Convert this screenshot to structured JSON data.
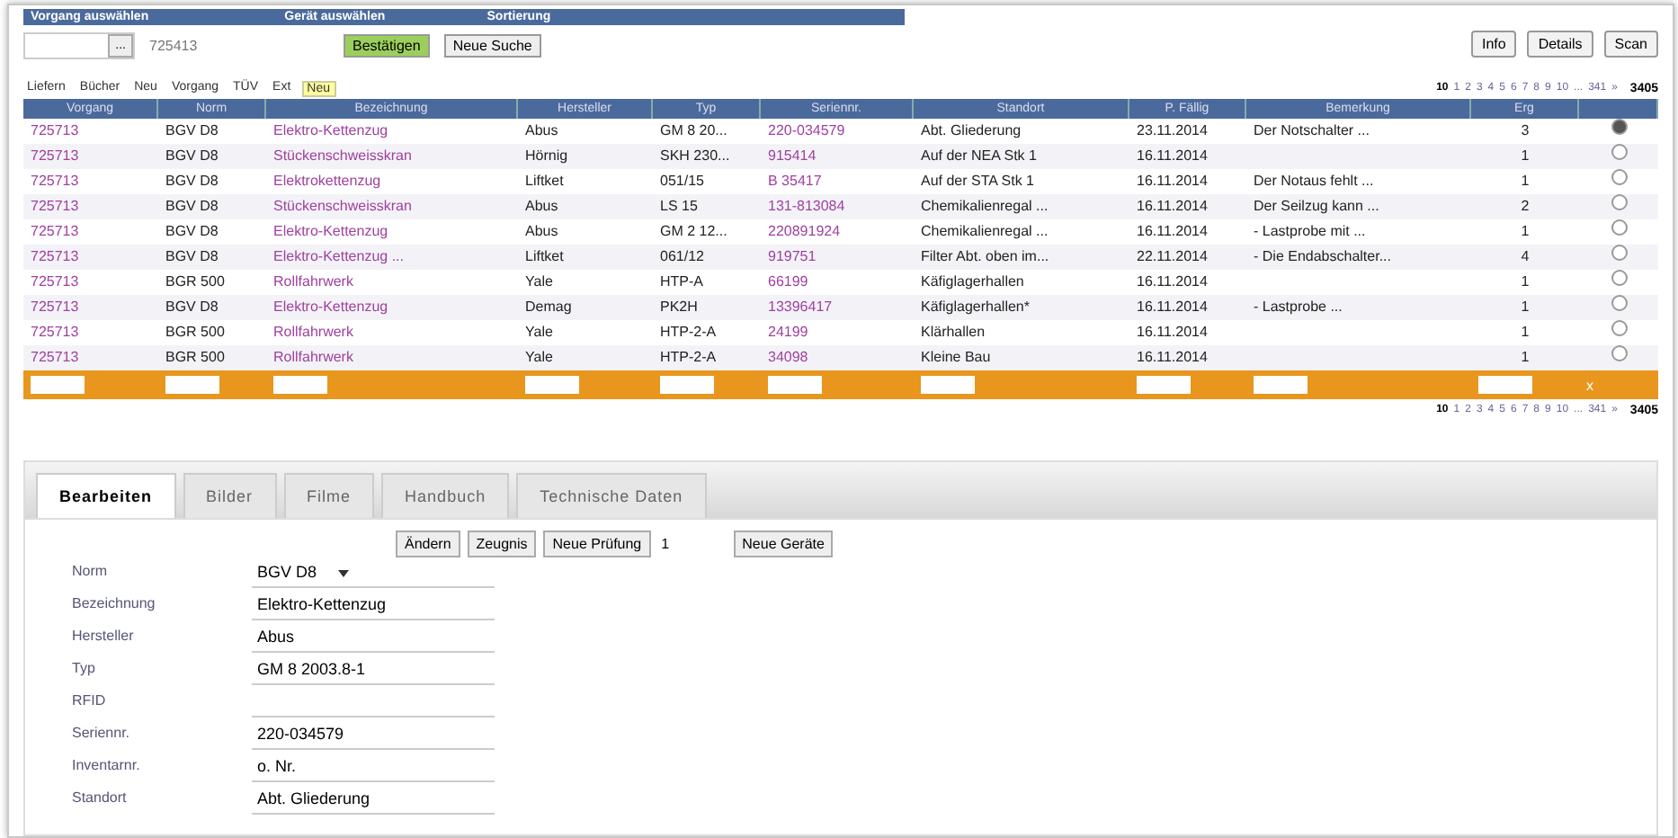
{
  "search_bar": {
    "headers": [
      "Vorgang auswählen",
      "Gerät auswählen",
      "Sortierung"
    ],
    "lookup_label": "...",
    "number": "725413",
    "buttons": [
      {
        "label": "Bestätigen",
        "kind": "primary"
      },
      {
        "label": "Neue Suche",
        "kind": "plain"
      }
    ]
  },
  "top_buttons": [
    "Info",
    "Details",
    "Scan"
  ],
  "filter_links": [
    {
      "label": "Liefern",
      "selected": false
    },
    {
      "label": "Bücher",
      "selected": false
    },
    {
      "label": "Neu",
      "selected": false
    },
    {
      "label": "Vorgang",
      "selected": false
    },
    {
      "label": "TÜV",
      "selected": false
    },
    {
      "label": "Ext",
      "selected": false
    },
    {
      "label": "Neu",
      "selected": true
    }
  ],
  "pager_top": {
    "pages": [
      "10",
      "1",
      "2",
      "3",
      "4",
      "5",
      "6",
      "7",
      "8",
      "9",
      "10",
      "...",
      "341",
      "»"
    ],
    "total": "3405"
  },
  "table": {
    "columns": [
      {
        "label": "Vorgang",
        "filterable": true
      },
      {
        "label": "Norm",
        "filterable": true
      },
      {
        "label": "Bezeichnung",
        "filterable": true
      },
      {
        "label": "Hersteller",
        "filterable": true
      },
      {
        "label": "Typ",
        "filterable": true
      },
      {
        "label": "Seriennr.",
        "filterable": true
      },
      {
        "label": "Standort",
        "filterable": true
      },
      {
        "label": "P. Fällig",
        "filterable": true
      },
      {
        "label": "Bemerkung",
        "filterable": true
      },
      {
        "label": "Erg",
        "filterable": true
      }
    ],
    "reset_label": "x",
    "rows": [
      {
        "cells": [
          "725713",
          "BGV D8",
          "Elektro-Kettenzug",
          "Abus",
          "GM 8 20...",
          "220-034579",
          "Abt. Gliederung",
          "23.11.2014",
          "Der Notschalter ...",
          "3"
        ],
        "selected": true
      },
      {
        "cells": [
          "725713",
          "BGV D8",
          "Stückenschweisskran",
          "Hörnig",
          "SKH 230...",
          "915414",
          "Auf der NEA Stk 1",
          "16.11.2014",
          "",
          "1"
        ],
        "selected": false
      },
      {
        "cells": [
          "725713",
          "BGV D8",
          "Elektrokettenzug",
          "Liftket",
          "051/15",
          "B 35417",
          "Auf der STA Stk 1",
          "16.11.2014",
          "Der Notaus fehlt ...",
          "1"
        ],
        "selected": false
      },
      {
        "cells": [
          "725713",
          "BGV D8",
          "Stückenschweisskran",
          "Abus",
          "LS 15",
          "131-813084",
          "Chemikalienregal ...",
          "16.11.2014",
          "Der Seilzug kann ...",
          "2"
        ],
        "selected": false
      },
      {
        "cells": [
          "725713",
          "BGV D8",
          "Elektro-Kettenzug",
          "Abus",
          "GM 2 12...",
          "220891924",
          "Chemikalienregal ...",
          "16.11.2014",
          "- Lastprobe mit ...",
          "1"
        ],
        "selected": false
      },
      {
        "cells": [
          "725713",
          "BGV D8",
          "Elektro-Kettenzug ...",
          "Liftket",
          "061/12",
          "919751",
          "Filter Abt. oben im...",
          "22.11.2014",
          "- Die Endabschalter...",
          "4"
        ],
        "selected": false
      },
      {
        "cells": [
          "725713",
          "BGR 500",
          "Rollfahrwerk",
          "Yale",
          "HTP-A",
          "66199",
          "Käfiglagerhallen",
          "16.11.2014",
          "",
          "1"
        ],
        "selected": false
      },
      {
        "cells": [
          "725713",
          "BGV D8",
          "Elektro-Kettenzug",
          "Demag",
          "PK2H",
          "13396417",
          "Käfiglagerhallen*",
          "16.11.2014",
          "- Lastprobe ...",
          "1"
        ],
        "selected": false
      },
      {
        "cells": [
          "725713",
          "BGR 500",
          "Rollfahrwerk",
          "Yale",
          "HTP-2-A",
          "24199",
          "Klärhallen",
          "16.11.2014",
          "",
          "1"
        ],
        "selected": false
      },
      {
        "cells": [
          "725713",
          "BGR 500",
          "Rollfahrwerk",
          "Yale",
          "HTP-2-A",
          "34098",
          "Kleine Bau",
          "16.11.2014",
          "",
          "1"
        ],
        "selected": false
      }
    ]
  },
  "pager_bottom": {
    "pages": [
      "10",
      "1",
      "2",
      "3",
      "4",
      "5",
      "6",
      "7",
      "8",
      "9",
      "10",
      "...",
      "341",
      "»"
    ],
    "total": "3405"
  },
  "tabs": [
    {
      "label": "Bearbeiten",
      "selected": true
    },
    {
      "label": "Bilder",
      "selected": false
    },
    {
      "label": "Filme",
      "selected": false
    },
    {
      "label": "Handbuch",
      "selected": false
    },
    {
      "label": "Technische Daten",
      "selected": false
    }
  ],
  "actions": [
    {
      "kind": "button",
      "label": "Ändern"
    },
    {
      "kind": "button",
      "label": "Zeugnis"
    },
    {
      "kind": "button",
      "label": "Neue Prüfung"
    },
    {
      "kind": "input",
      "value": "1"
    },
    {
      "kind": "button",
      "label": "Neue Geräte"
    }
  ],
  "form": [
    {
      "label": "Norm",
      "kind": "select",
      "value": "BGV D8"
    },
    {
      "label": "Bezeichnung",
      "kind": "text",
      "value": "Elektro-Kettenzug"
    },
    {
      "label": "Hersteller",
      "kind": "text",
      "value": "Abus"
    },
    {
      "label": "Typ",
      "kind": "text",
      "value": "GM 8 2003.8-1"
    },
    {
      "label": "RFID",
      "kind": "text"
    },
    {
      "label": "Seriennr.",
      "kind": "text",
      "value": "220-034579"
    },
    {
      "label": "Inventarnr.",
      "kind": "text",
      "value": "o. Nr."
    },
    {
      "label": "Standort",
      "kind": "text",
      "value": "Abt. Gliederung"
    }
  ]
}
